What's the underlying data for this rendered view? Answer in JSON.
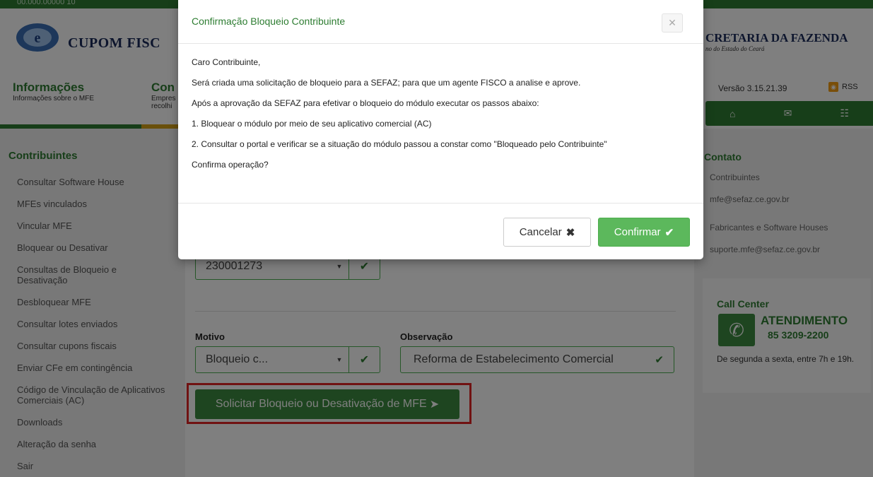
{
  "header": {
    "brand": "CUPOM FISC",
    "sefaz_title": "CRETARIA DA FAZENDA",
    "sefaz_subtitle": "no do Estado do Ceará",
    "top_mini": "00.000.00000 10"
  },
  "nav": {
    "info_title": "Informações",
    "info_sub": "Informações sobre o MFE",
    "cont_title": "Con",
    "cont_sub1": "Empres",
    "cont_sub2": "recolhi",
    "versao": "Versão 3.15.21.39",
    "rss": "RSS"
  },
  "sidebar": {
    "title": "Contribuintes",
    "items": [
      {
        "label": "Consultar Software House"
      },
      {
        "label": "MFEs vinculados"
      },
      {
        "label": "Vincular MFE"
      },
      {
        "label": "Bloquear ou Desativar"
      },
      {
        "label": "Consultas de Bloqueio e Desativação"
      },
      {
        "label": "Desbloquear MFE"
      },
      {
        "label": "Consultar lotes enviados"
      },
      {
        "label": "Consultar cupons fiscais"
      },
      {
        "label": "Enviar CFe em contingência"
      },
      {
        "label": "Código de Vinculação de Aplicativos Comerciais (AC)"
      },
      {
        "label": "Downloads"
      },
      {
        "label": "Alteração da senha"
      },
      {
        "label": "Sair"
      }
    ]
  },
  "form": {
    "mfe_select_value": "230001273",
    "motivo_label": "Motivo",
    "motivo_value": "Bloqueio c...",
    "observacao_label": "Observação",
    "observacao_value": "Reforma de Estabelecimento Comercial",
    "submit_label": "Solicitar Bloqueio ou Desativação de MFE"
  },
  "right": {
    "contato_title": "Contato",
    "contribuintes": "Contribuintes",
    "email1": "mfe@sefaz.ce.gov.br",
    "fabricantes": "Fabricantes e Software Houses",
    "email2": "suporte.mfe@sefaz.ce.gov.br",
    "call_center": "Call Center",
    "atendimento": "ATENDIMENTO",
    "phone": "85 3209-2200",
    "hours": "De segunda a sexta, entre 7h e 19h."
  },
  "modal": {
    "title": "Confirmação Bloqueio Contribuinte",
    "lines": [
      "Caro Contribuinte,",
      "Será criada uma solicitação de bloqueio para a SEFAZ; para que um agente FISCO a analise e aprove.",
      "Após a aprovação da SEFAZ para efetivar o bloqueio do módulo executar os passos abaixo:",
      "1. Bloquear o módulo por meio de seu aplicativo comercial (AC)",
      "2. Consultar o portal e verificar se a situação do módulo passou a constar como \"Bloqueado pelo Contribuinte\"",
      "Confirma operação?"
    ],
    "cancel_label": "Cancelar",
    "confirm_label": "Confirmar"
  },
  "colors": {
    "brand_green": "#2e7d32",
    "confirm_green": "#5cb85c",
    "highlight_red": "#e02424"
  }
}
